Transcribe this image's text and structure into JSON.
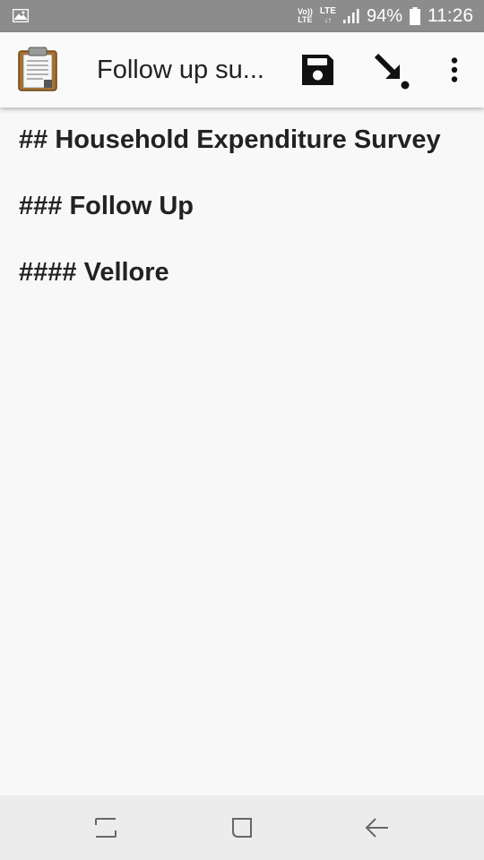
{
  "status_bar": {
    "left_icon": "image-icon",
    "volte_top": "Vo))",
    "volte_bottom": "LTE",
    "network_label": "LTE",
    "battery_percent": "94%",
    "time": "11:26"
  },
  "app_bar": {
    "app_icon": "clipboard-icon",
    "title": "Follow up su...",
    "actions": [
      "save-icon",
      "move-icon",
      "more-vert-icon"
    ]
  },
  "document": {
    "lines": [
      "## Household Expenditure Survey",
      "### Follow Up",
      "#### Vellore"
    ]
  },
  "nav_bar": {
    "buttons": [
      "recents-icon",
      "home-icon",
      "back-icon"
    ]
  },
  "colors": {
    "status_bar": "#8c8c8c",
    "app_bar": "#fafafa",
    "background": "#f8f8f8",
    "text": "#222222",
    "nav_bar": "#ececec"
  }
}
